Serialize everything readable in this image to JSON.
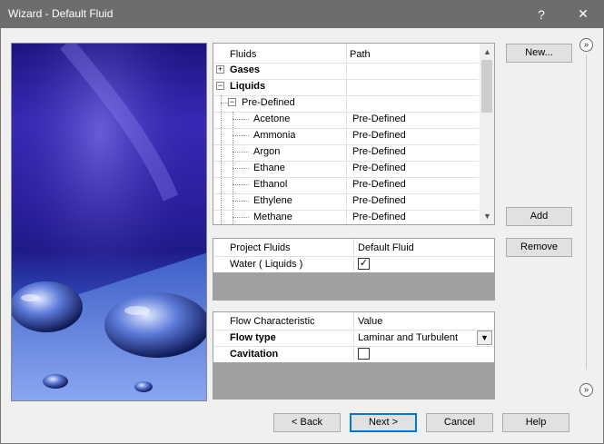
{
  "window": {
    "title": "Wizard - Default Fluid",
    "help_glyph": "?",
    "close_glyph": "✕"
  },
  "fluids_tree": {
    "columns": [
      "Fluids",
      "Path"
    ],
    "rows": [
      {
        "label": "Gases",
        "path": "",
        "bold": true,
        "expander": "+"
      },
      {
        "label": "Liquids",
        "path": "",
        "bold": true,
        "expander": "−"
      },
      {
        "label": "Pre-Defined",
        "path": "",
        "bold": false,
        "expander": "−"
      },
      {
        "label": "Acetone",
        "path": "Pre-Defined"
      },
      {
        "label": "Ammonia",
        "path": "Pre-Defined"
      },
      {
        "label": "Argon",
        "path": "Pre-Defined"
      },
      {
        "label": "Ethane",
        "path": "Pre-Defined"
      },
      {
        "label": "Ethanol",
        "path": "Pre-Defined"
      },
      {
        "label": "Ethylene",
        "path": "Pre-Defined"
      },
      {
        "label": "Methane",
        "path": "Pre-Defined"
      }
    ]
  },
  "project_fluids": {
    "columns": [
      "Project Fluids",
      "Default Fluid"
    ],
    "rows": [
      {
        "label": "Water ( Liquids )",
        "checked": true,
        "check_glyph": "✓"
      }
    ]
  },
  "flow_properties": {
    "columns": [
      "Flow Characteristic",
      "Value"
    ],
    "flow_type_label": "Flow type",
    "flow_type_value": "Laminar and Turbulent",
    "cavitation_label": "Cavitation",
    "cavitation_checked": false
  },
  "side_buttons": {
    "new_label": "New...",
    "add_label": "Add",
    "remove_label": "Remove",
    "collapse_glyph": "»"
  },
  "footer": {
    "back_label": "< Back",
    "next_label": "Next >",
    "cancel_label": "Cancel",
    "help_label": "Help"
  },
  "colors": {
    "titlebar": "#6d6d6d",
    "default_button_border": "#0078d7",
    "gray_area": "#a0a0a0"
  }
}
